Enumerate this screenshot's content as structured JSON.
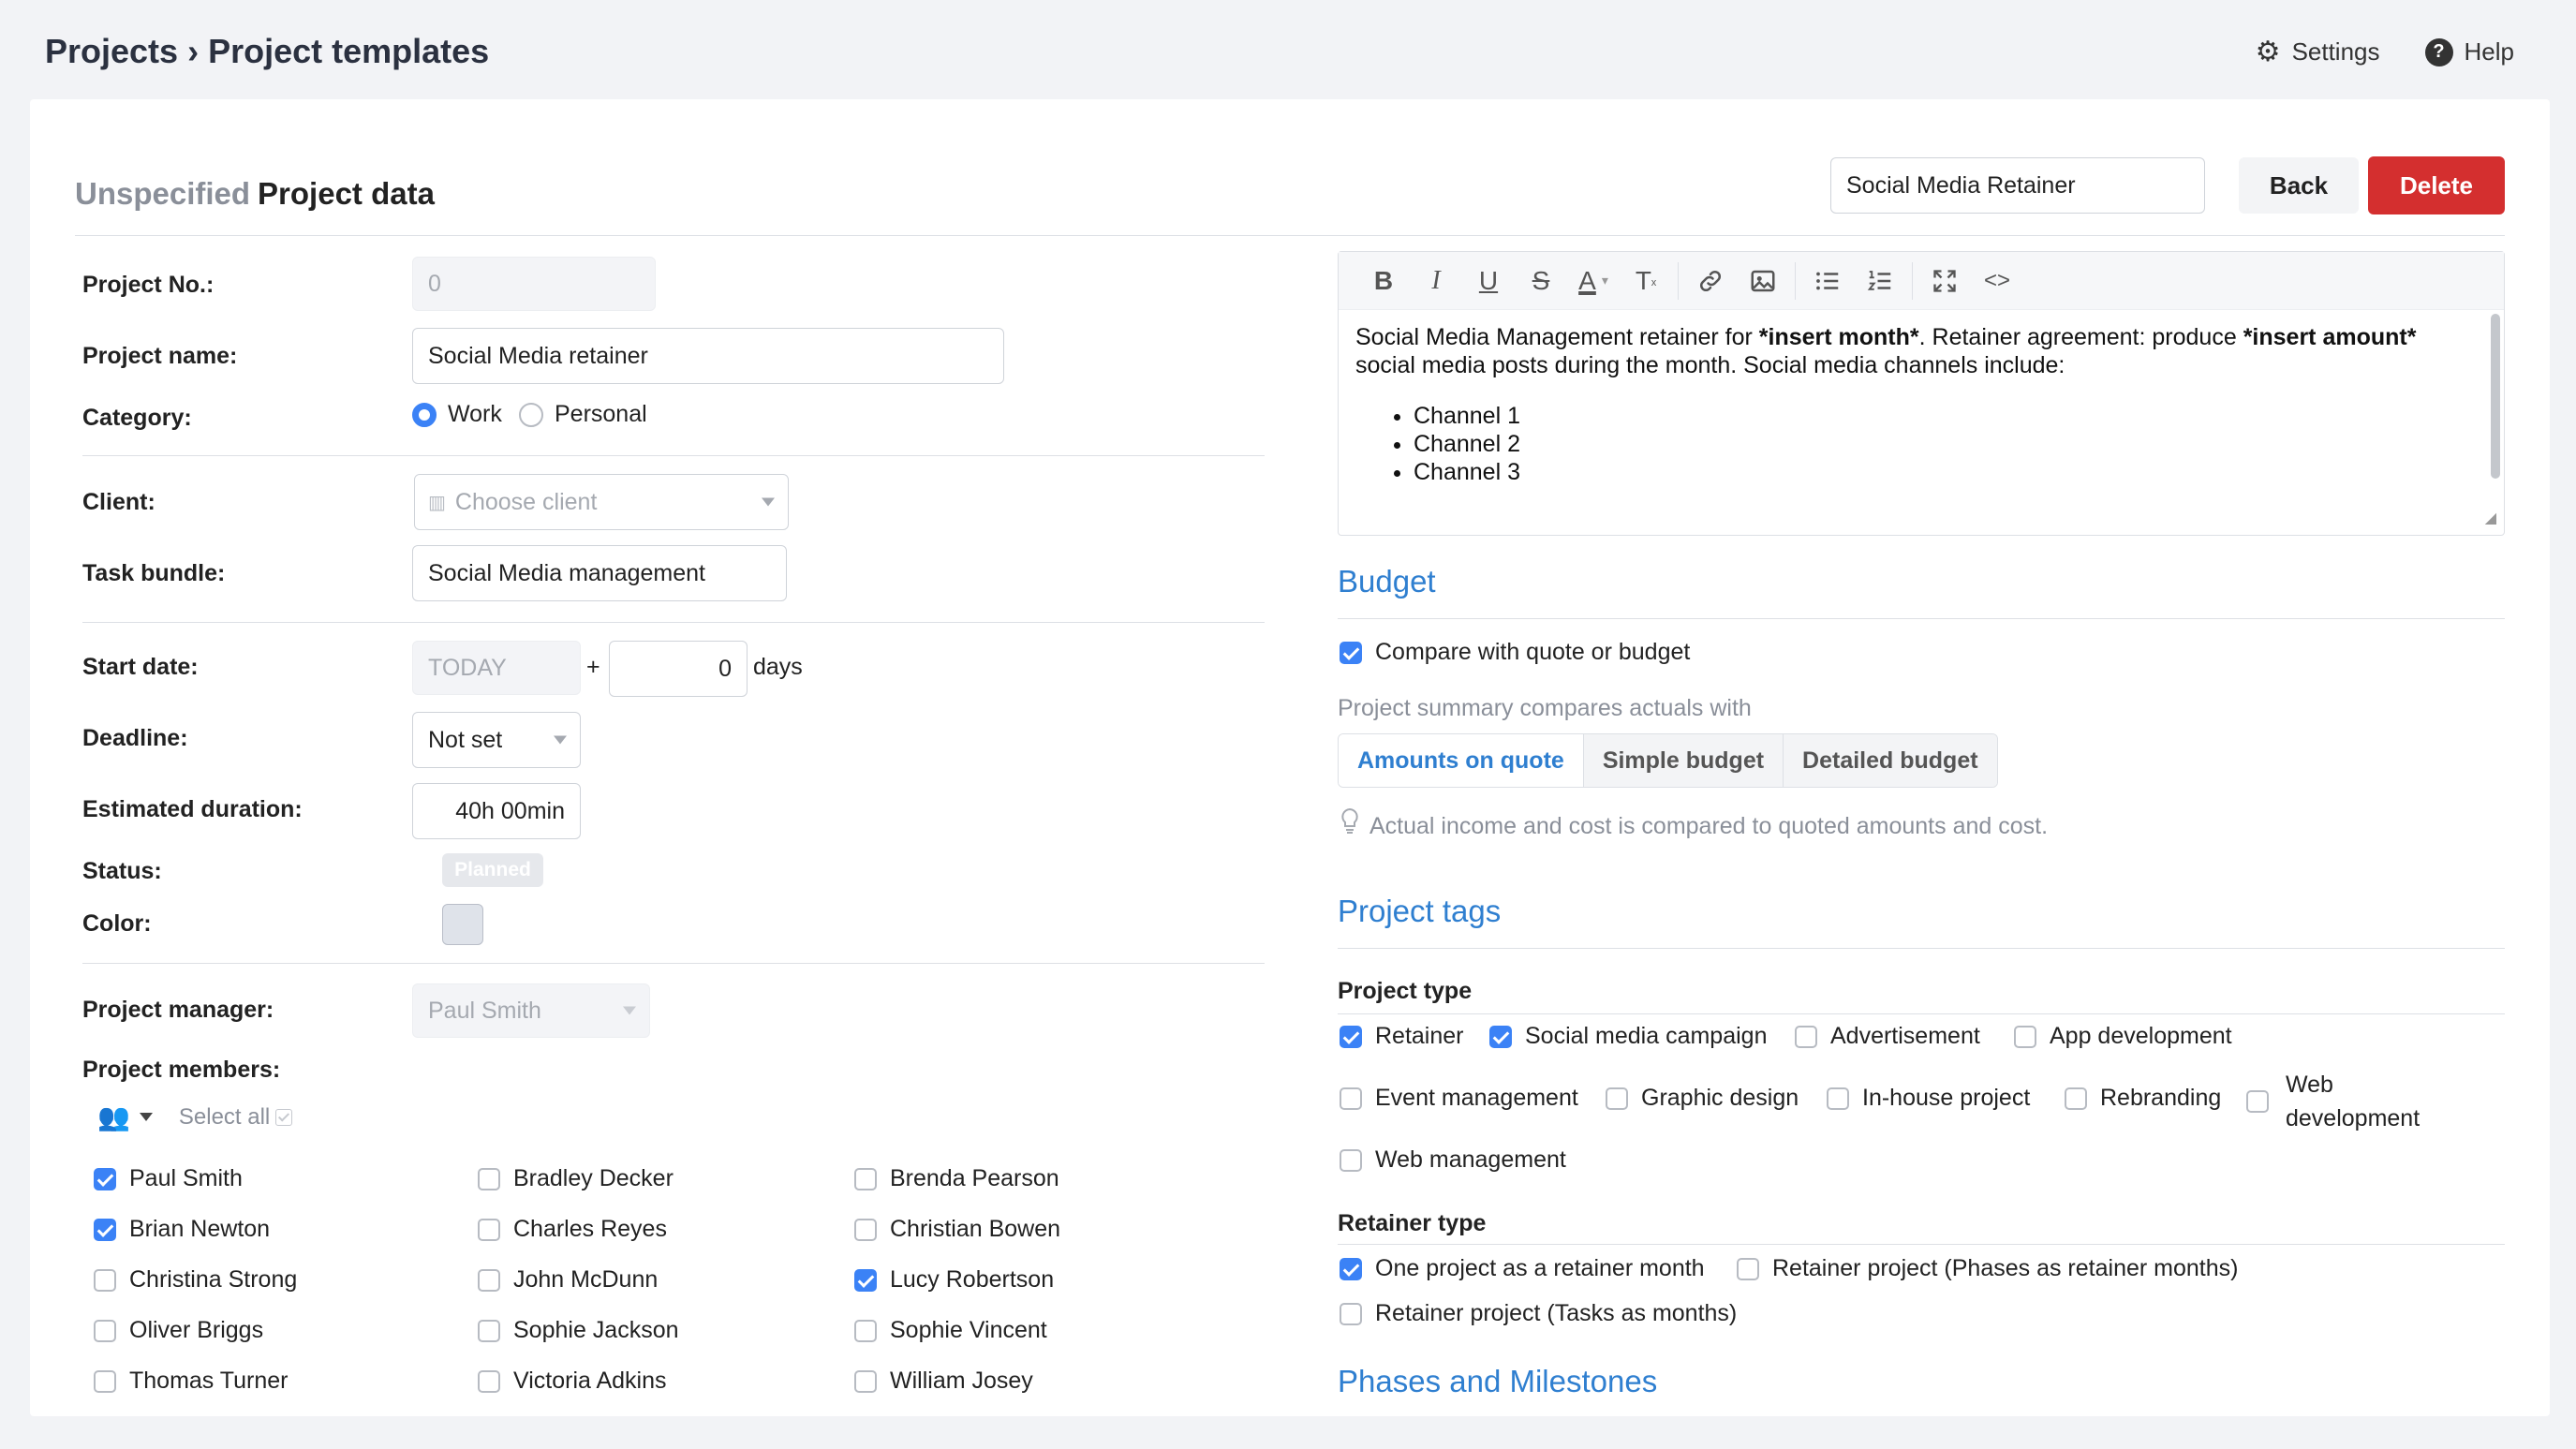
{
  "breadcrumb": {
    "parent": "Projects",
    "separator": "›",
    "current": "Project templates"
  },
  "top_actions": {
    "settings_label": "Settings",
    "help_label": "Help",
    "help_glyph": "?"
  },
  "header": {
    "muted": "Unspecified",
    "title": "Project data",
    "template_name": "Social Media Retainer",
    "back_label": "Back",
    "delete_label": "Delete"
  },
  "form": {
    "project_no": {
      "label": "Project No.:",
      "value": "0"
    },
    "project_name": {
      "label": "Project name:",
      "value": "Social Media retainer"
    },
    "category": {
      "label": "Category:",
      "options": [
        "Work",
        "Personal"
      ],
      "selected": "Work"
    },
    "client": {
      "label": "Client:",
      "placeholder": "Choose client"
    },
    "task_bundle": {
      "label": "Task bundle:",
      "value": "Social Media management"
    },
    "start_date": {
      "label": "Start date:",
      "value": "TODAY",
      "plus": "+",
      "offset": "0",
      "unit": "days"
    },
    "deadline": {
      "label": "Deadline:",
      "value": "Not set"
    },
    "estimated_duration": {
      "label": "Estimated duration:",
      "value": "40h 00min"
    },
    "status": {
      "label": "Status:",
      "value": "Planned"
    },
    "color": {
      "label": "Color:",
      "value": "#dfe3ea"
    },
    "project_manager": {
      "label": "Project manager:",
      "value": "Paul Smith"
    },
    "project_members": {
      "label": "Project members:",
      "select_all": "Select all",
      "members": [
        {
          "name": "Paul Smith",
          "checked": true
        },
        {
          "name": "Brian Newton",
          "checked": true
        },
        {
          "name": "Christina Strong",
          "checked": false
        },
        {
          "name": "Oliver Briggs",
          "checked": false
        },
        {
          "name": "Thomas Turner",
          "checked": false
        },
        {
          "name": "Bradley Decker",
          "checked": false
        },
        {
          "name": "Charles Reyes",
          "checked": false
        },
        {
          "name": "John McDunn",
          "checked": false
        },
        {
          "name": "Sophie Jackson",
          "checked": false
        },
        {
          "name": "Victoria Adkins",
          "checked": false
        },
        {
          "name": "Brenda Pearson",
          "checked": false
        },
        {
          "name": "Christian Bowen",
          "checked": false
        },
        {
          "name": "Lucy Robertson",
          "checked": true
        },
        {
          "name": "Sophie Vincent",
          "checked": false
        },
        {
          "name": "William Josey",
          "checked": false
        }
      ]
    }
  },
  "editor": {
    "toolbar": {
      "bold": "B",
      "italic": "I",
      "underline": "U",
      "strike": "S",
      "text_color": "A",
      "clear_format": "T",
      "code": "<>"
    },
    "text_before": "Social Media Management retainer for ",
    "bold1": "*insert month*",
    "text_mid": ". Retainer agreement: produce ",
    "bold2": "*insert amount*",
    "text_after": " social media posts during the month. Social media channels include:",
    "bullets": [
      "Channel 1",
      "Channel 2",
      "Channel 3"
    ]
  },
  "budget": {
    "title": "Budget",
    "compare_label": "Compare with quote or budget",
    "compare_checked": true,
    "summary_hint": "Project summary compares actuals with",
    "tabs": [
      "Amounts on quote",
      "Simple budget",
      "Detailed budget"
    ],
    "active_tab": "Amounts on quote",
    "info": "Actual income and cost is compared to quoted amounts and cost."
  },
  "tags": {
    "title": "Project tags",
    "project_type_title": "Project type",
    "project_types": [
      {
        "label": "Retainer",
        "checked": true
      },
      {
        "label": "Social media campaign",
        "checked": true
      },
      {
        "label": "Advertisement",
        "checked": false
      },
      {
        "label": "App development",
        "checked": false
      },
      {
        "label": "Event management",
        "checked": false
      },
      {
        "label": "Graphic design",
        "checked": false
      },
      {
        "label": "In-house project",
        "checked": false
      },
      {
        "label": "Rebranding",
        "checked": false
      },
      {
        "label": "Web development",
        "line1": "Web",
        "line2": "development",
        "checked": false
      },
      {
        "label": "Web management",
        "checked": false
      }
    ],
    "retainer_type_title": "Retainer type",
    "retainer_types": [
      {
        "label": "One project as a retainer month",
        "checked": true
      },
      {
        "label": "Retainer project (Phases as retainer months)",
        "checked": false
      },
      {
        "label": "Retainer project (Tasks as months)",
        "checked": false
      }
    ]
  },
  "phases": {
    "title": "Phases and Milestones"
  },
  "colors": {
    "accent": "#2f7fd0",
    "checkbox": "#3b82f6",
    "delete": "#d42f2f"
  },
  "icons": [
    "gear-icon",
    "help-icon",
    "caret-down-icon",
    "people-icon",
    "link-icon",
    "image-icon",
    "bullet-list-icon",
    "numbered-list-icon",
    "fullscreen-icon",
    "code-icon",
    "lightbulb-icon",
    "building-icon"
  ]
}
